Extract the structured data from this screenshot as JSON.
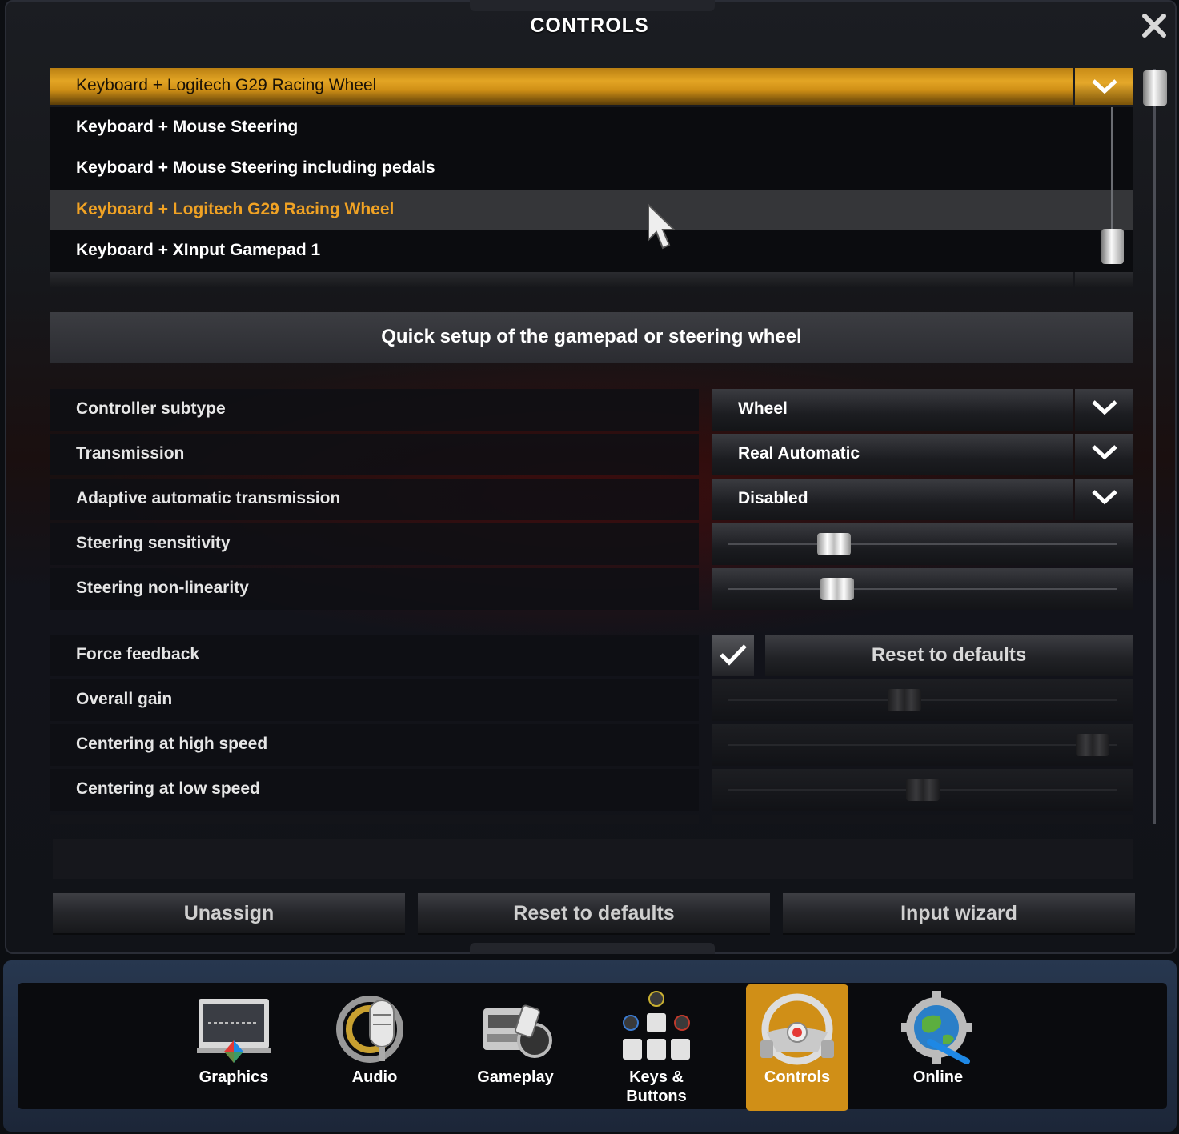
{
  "window": {
    "title": "CONTROLS"
  },
  "profile_dropdown": {
    "selected": "Keyboard + Logitech G29 Racing Wheel",
    "options": [
      "Keyboard + Mouse Steering",
      "Keyboard + Mouse Steering including pedals",
      "Keyboard + Logitech G29 Racing Wheel",
      "Keyboard + XInput Gamepad 1"
    ],
    "hovered_index": 2
  },
  "quick_setup": {
    "label": "Quick setup of the gamepad or steering wheel"
  },
  "settings": {
    "controller_subtype": {
      "label": "Controller subtype",
      "value": "Wheel"
    },
    "transmission": {
      "label": "Transmission",
      "value": "Real Automatic"
    },
    "adaptive": {
      "label": "Adaptive automatic transmission",
      "value": "Disabled"
    },
    "steering_sensitivity": {
      "label": "Steering sensitivity",
      "level": 0.25
    },
    "steering_nonlinearity": {
      "label": "Steering non-linearity",
      "level": 0.26
    },
    "force_feedback": {
      "label": "Force feedback",
      "checked": true,
      "reset_label": "Reset to defaults"
    },
    "overall_gain": {
      "label": "Overall gain",
      "level": 0.45
    },
    "centering_high": {
      "label": "Centering at high speed",
      "level": 0.98
    },
    "centering_low": {
      "label": "Centering at low speed",
      "level": 0.5
    }
  },
  "actions": {
    "unassign": "Unassign",
    "reset": "Reset to defaults",
    "wizard": "Input wizard"
  },
  "nav": {
    "items": [
      {
        "label": "Graphics",
        "icon": "monitor-icon"
      },
      {
        "label": "Audio",
        "icon": "microphone-icon"
      },
      {
        "label": "Gameplay",
        "icon": "truck-icon"
      },
      {
        "label": "Keys &\nButtons",
        "icon": "keys-buttons-icon"
      },
      {
        "label": "Controls",
        "icon": "steering-wheel-icon",
        "active": true
      },
      {
        "label": "Online",
        "icon": "globe-gear-icon"
      }
    ]
  },
  "colors": {
    "accent": "#e0a020",
    "hover_text": "#f0a224"
  }
}
